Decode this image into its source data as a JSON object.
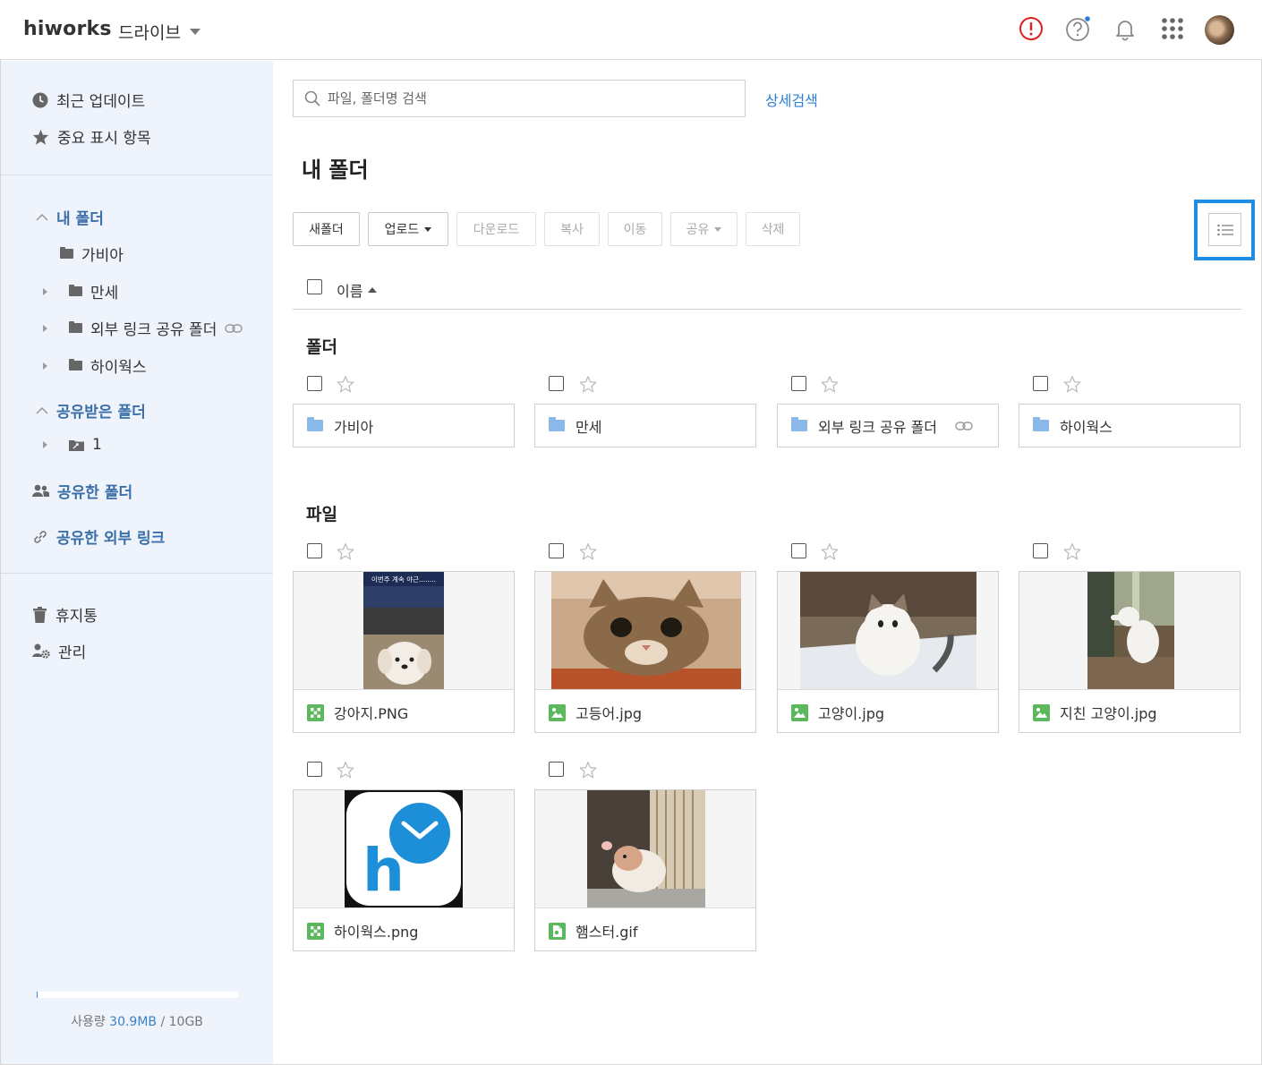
{
  "header": {
    "logo": "hiworks",
    "app_name": "드라이브"
  },
  "sidebar": {
    "recent": "최근 업데이트",
    "starred": "중요 표시 항목",
    "my_folder": "내 폴더",
    "my_folder_children": [
      "가비아",
      "만세",
      "외부 링크 공유 폴더",
      "하이웍스"
    ],
    "shared_with_me": "공유받은 폴더",
    "shared_with_me_children": [
      "1"
    ],
    "shared_folders": "공유한 폴더",
    "shared_links": "공유한 외부 링크",
    "trash": "휴지통",
    "admin": "관리",
    "storage": {
      "label": "사용량",
      "used": "30.9MB",
      "separator": "/",
      "total": "10GB",
      "used_fraction": 0.003
    }
  },
  "main": {
    "search_placeholder": "파일, 폴더명 검색",
    "advanced_search": "상세검색",
    "title": "내 폴더",
    "toolbar": {
      "new_folder": "새폴더",
      "upload": "업로드",
      "download": "다운로드",
      "copy": "복사",
      "move": "이동",
      "share": "공유",
      "delete": "삭제"
    },
    "column_name": "이름",
    "folders_title": "폴더",
    "folders": [
      "가비아",
      "만세",
      "외부 링크 공유 폴더",
      "하이웍스"
    ],
    "files_title": "파일",
    "files": [
      "강아지.PNG",
      "고등어.jpg",
      "고양이.jpg",
      "지친 고양이.jpg",
      "하이웍스.png",
      "햄스터.gif"
    ],
    "thumb_caption": "이번주 계속 야근........"
  },
  "colors": {
    "accent": "#1e8de6",
    "link": "#2b7fd4",
    "sidebar_bg": "#eef3fc",
    "folder": "#8ab8e8",
    "image_icon": "#5cb85c",
    "alert": "#e02020"
  }
}
